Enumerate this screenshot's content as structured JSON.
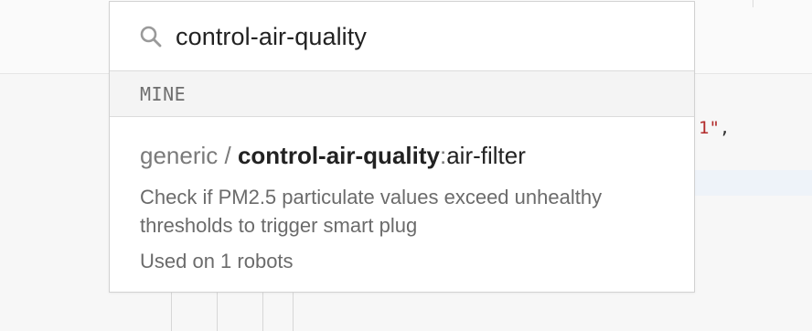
{
  "search": {
    "value": "control-air-quality",
    "icon": "search-icon"
  },
  "section": {
    "label": "MINE"
  },
  "result": {
    "namespace": "generic",
    "separator": " / ",
    "module": "control-air-quality",
    "colon": ":",
    "model": "air-filter",
    "description": "Check if PM2.5 particulate values exceed unhealthy thresholds to trigger smart plug",
    "usage": "Used on 1 robots"
  },
  "background": {
    "code_string_fragment": "1\"",
    "code_punct": ","
  },
  "colors": {
    "string": "#b22a2a",
    "accent_highlight": "#eef3f9"
  }
}
